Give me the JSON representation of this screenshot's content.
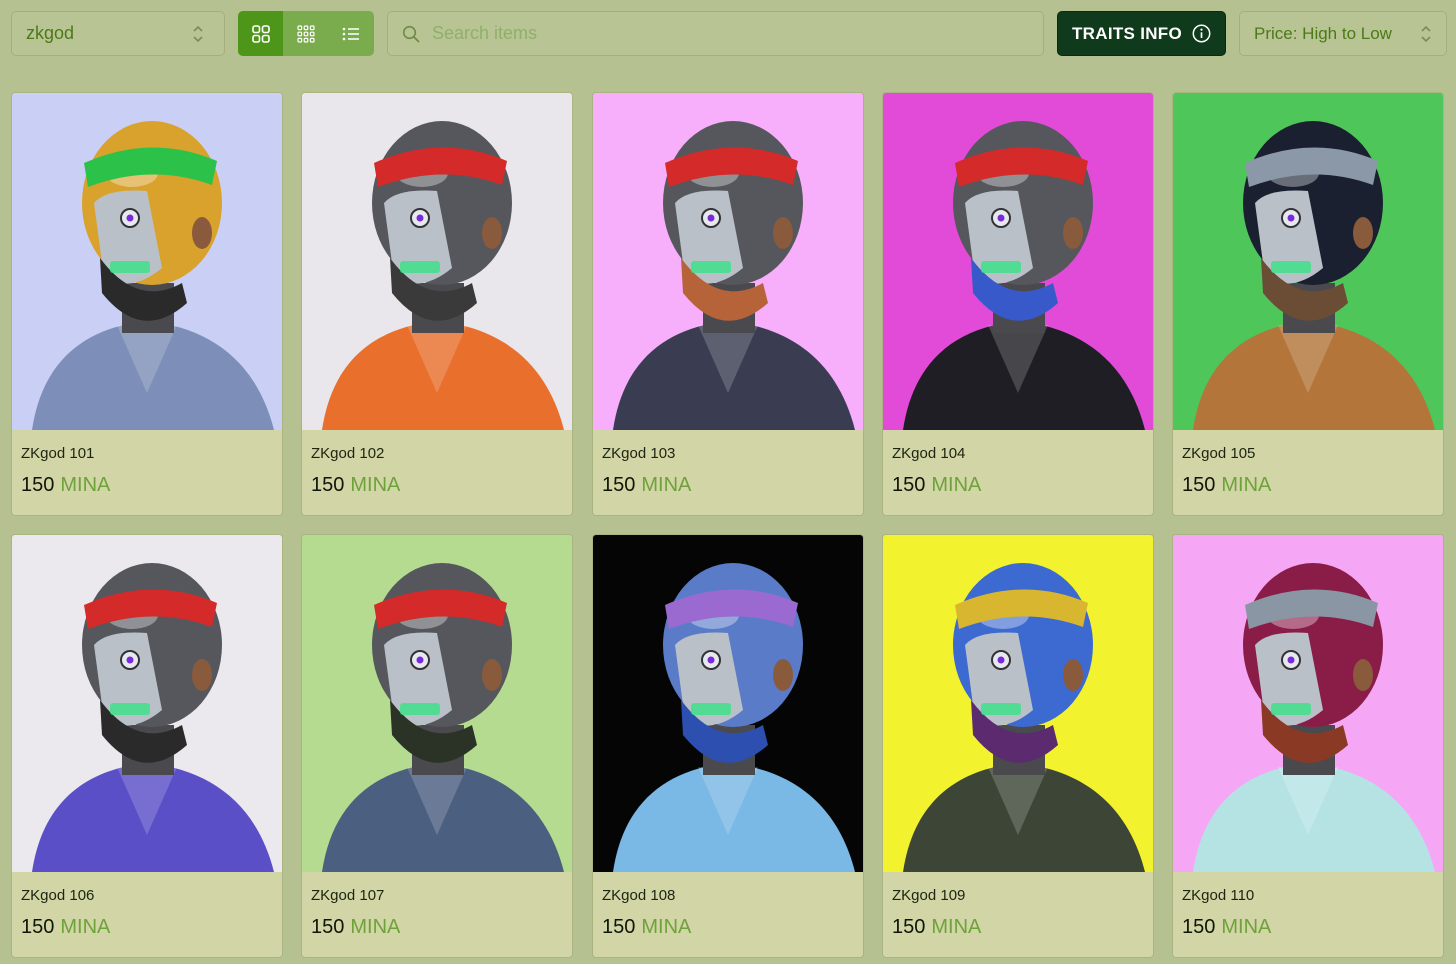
{
  "toolbar": {
    "collection": "zkgod",
    "search_placeholder": "Search items",
    "traits_label": "TRAITS INFO",
    "sort_label": "Price: High to Low",
    "view_modes": [
      "large-grid-icon",
      "small-grid-icon",
      "list-icon"
    ],
    "active_view": "large-grid-icon"
  },
  "colors": {
    "page_bg": "#b5c191",
    "accent_green": "#4e961a",
    "dark_button": "#0f3a1c",
    "currency_green": "#6ea23a"
  },
  "items": [
    {
      "name": "ZKgod 101",
      "price": "150",
      "currency": "MINA",
      "bg": "#c9cff5",
      "helmet": "#d9a22c",
      "visor": "#2cc24a",
      "body": "#7d8fb8",
      "beard": "#2a2a2a"
    },
    {
      "name": "ZKgod 102",
      "price": "150",
      "currency": "MINA",
      "bg": "#eae7ec",
      "helmet": "#55575c",
      "visor": "#d42a2a",
      "body": "#e86f2c",
      "beard": "#3a3a3a"
    },
    {
      "name": "ZKgod 103",
      "price": "150",
      "currency": "MINA",
      "bg": "#f7aefb",
      "helmet": "#55575c",
      "visor": "#d42a2a",
      "body": "#3a3d52",
      "beard": "#b7633a"
    },
    {
      "name": "ZKgod 104",
      "price": "150",
      "currency": "MINA",
      "bg": "#e24bd7",
      "helmet": "#55575c",
      "visor": "#d42a2a",
      "body": "#1e1e24",
      "beard": "#3859c9"
    },
    {
      "name": "ZKgod 105",
      "price": "150",
      "currency": "MINA",
      "bg": "#4fc65a",
      "helmet": "#1a2030",
      "visor": "#8a98a8",
      "body": "#b3753a",
      "beard": "#6b4c35"
    },
    {
      "name": "ZKgod 106",
      "price": "150",
      "currency": "MINA",
      "bg": "#ece9ee",
      "helmet": "#55575c",
      "visor": "#d42a2a",
      "body": "#5b4fc8",
      "beard": "#2a2a2a"
    },
    {
      "name": "ZKgod 107",
      "price": "150",
      "currency": "MINA",
      "bg": "#b4db8f",
      "helmet": "#55575c",
      "visor": "#d42a2a",
      "body": "#4b5f80",
      "beard": "#2b3326"
    },
    {
      "name": "ZKgod 108",
      "price": "150",
      "currency": "MINA",
      "bg": "#050505",
      "helmet": "#5a7bc8",
      "visor": "#9a6ad0",
      "body": "#7ab8e6",
      "beard": "#2c4fb0"
    },
    {
      "name": "ZKgod 109",
      "price": "150",
      "currency": "MINA",
      "bg": "#f3f22e",
      "helmet": "#3d6ad0",
      "visor": "#d8b630",
      "body": "#3c4536",
      "beard": "#5c2a6e"
    },
    {
      "name": "ZKgod 110",
      "price": "150",
      "currency": "MINA",
      "bg": "#f5a7f6",
      "helmet": "#8a1d48",
      "visor": "#8b96a4",
      "body": "#b5e3e4",
      "beard": "#8a3a24"
    }
  ]
}
